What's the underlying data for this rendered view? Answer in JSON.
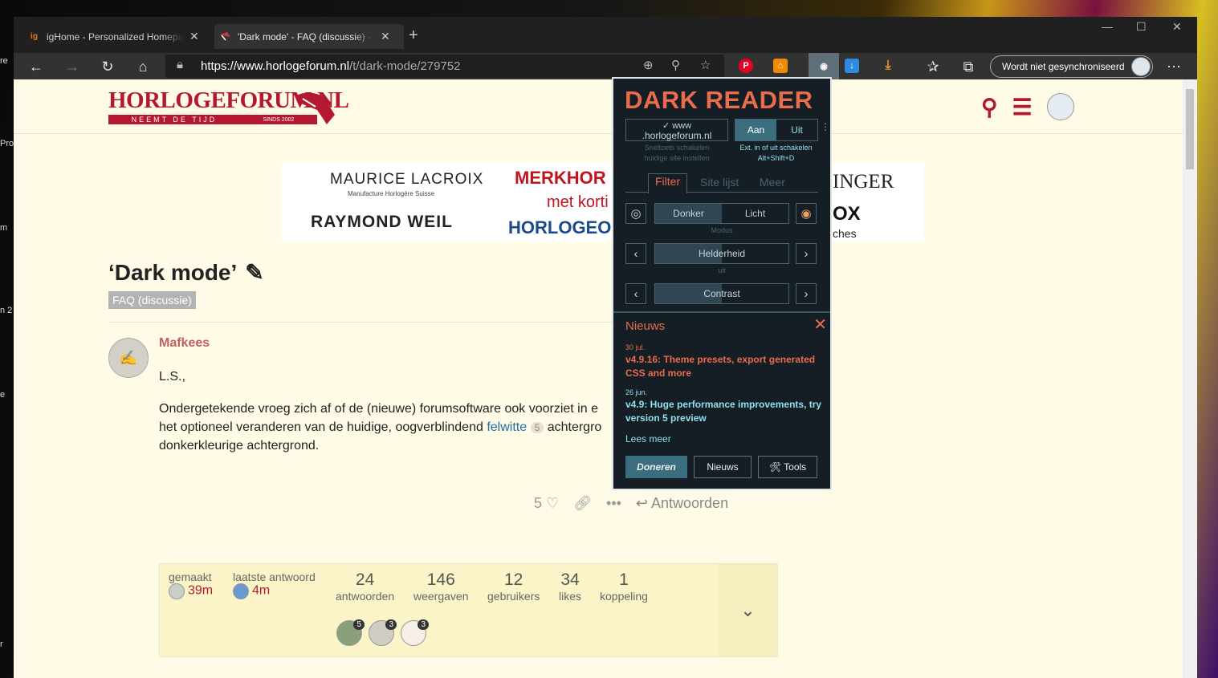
{
  "browser": {
    "tabs": [
      {
        "label": "igHome - Personalized Homepage",
        "favicon": "ig"
      },
      {
        "label": "'Dark mode' - FAQ (discussie) - Horlogeforum",
        "favicon": "bird"
      }
    ],
    "url_host": "https://www.horlogeforum.nl",
    "url_path": "/t/dark-mode/279752",
    "sync_label": "Wordt niet gesynchroniseerd"
  },
  "desktop_labels": [
    "re",
    "Pro",
    "m",
    "n 2",
    "e",
    "r"
  ],
  "site": {
    "logo_text": "HORLOGEFORUM.NL",
    "logo_tagline": "NEEMT DE TIJD",
    "logo_since": "SINDS 2002",
    "banner": {
      "col1_top": "MAURICE LACROIX",
      "col1_sub": "Manufacture Horlogère Suisse",
      "col1_bottom": "RAYMOND WEIL",
      "col2_top": "MERKHOR",
      "col2_mid": "met korti",
      "col2_bottom": "HORLOGEO",
      "col3_top": "INGER",
      "col3_mid": "OX",
      "col3_bottom": "ches"
    }
  },
  "topic": {
    "title": "‘Dark mode’",
    "category": "FAQ (discussie)",
    "author": "Mafkees",
    "greeting": "L.S.,",
    "line1": "Ondergetekende vroeg zich af of de (nieuwe) forumsoftware ook voorziet in e",
    "line2_a": "het optioneel veranderen van de huidige, oogverblindend ",
    "line2_link": "felwitte",
    "line2_count": "5",
    "line2_b": " achtergro",
    "line3": "donkerkleurige achtergrond.",
    "likes": "5",
    "reply_label": "Antwoorden"
  },
  "stats": {
    "created_label": "gemaakt",
    "created_value": "39m",
    "last_reply_label": "laatste antwoord",
    "last_reply_value": "4m",
    "items": [
      {
        "num": "24",
        "label": "antwoorden"
      },
      {
        "num": "146",
        "label": "weergaven"
      },
      {
        "num": "12",
        "label": "gebruikers"
      },
      {
        "num": "34",
        "label": "likes"
      },
      {
        "num": "1",
        "label": "koppeling"
      }
    ],
    "participant_counts": [
      "5",
      "3",
      "3"
    ]
  },
  "dark_reader": {
    "title": "DARK READER",
    "site_line1": "✓ www",
    "site_line2": ".horlogeforum.nl",
    "toggle_on": "Aan",
    "toggle_off": "Uit",
    "hint_left_1": "Sneltoets schakelen",
    "hint_left_2": "huidige site instellen",
    "hint_right_1": "Ext. in of uit schakelen",
    "hint_right_2": "Alt+Shift+D",
    "tab_filter": "Filter",
    "tab_sites": "Site lijst",
    "tab_more": "Meer",
    "mode_dark": "Donker",
    "mode_light": "Licht",
    "mode_label": "Modus",
    "brightness_label": "Helderheid",
    "brightness_sub": "uit",
    "contrast_label": "Contrast",
    "news_title": "Nieuws",
    "news": [
      {
        "date": "30 jul.",
        "text": "v4.9.16: Theme presets, export generated CSS and more"
      },
      {
        "date": "26 jun.",
        "text": "v4.9: Huge performance improvements, try version 5 preview"
      }
    ],
    "read_more": "Lees meer",
    "btn_donate": "Doneren",
    "btn_news": "Nieuws",
    "btn_tools": "🛠 Tools"
  },
  "colors": {
    "brand_red": "#b41830",
    "dr_orange": "#e96c4c",
    "dr_bg": "#141e24",
    "page_bg": "#fffbe7"
  }
}
